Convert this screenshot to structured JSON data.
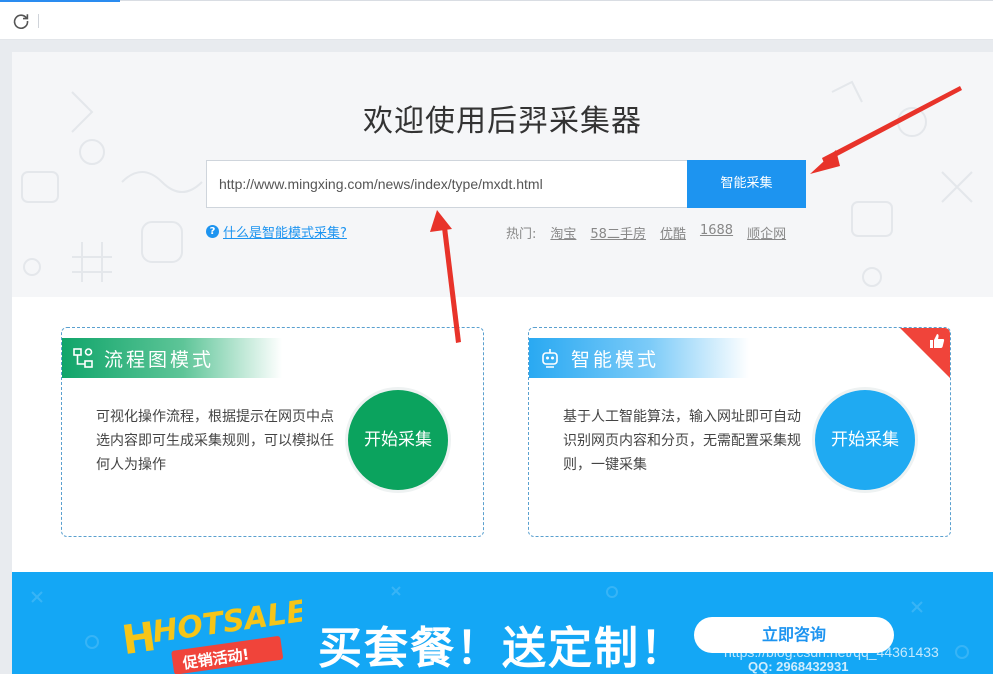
{
  "browser": {
    "refresh_icon": "refresh-icon"
  },
  "hero": {
    "title": "欢迎使用后羿采集器",
    "url_value": "http://www.mingxing.com/news/index/type/mxdt.html",
    "smart_button": "智能采集",
    "help_text": "什么是智能模式采集?",
    "hot_label": "热门:",
    "hot_links": [
      "淘宝",
      "58二手房",
      "优酷",
      "1688",
      "顺企网"
    ]
  },
  "cards": [
    {
      "title": "流程图模式",
      "icon": "flowchart-icon",
      "description": "可视化操作流程，根据提示在网页中点选内容即可生成采集规则，可以模拟任何人为操作",
      "button": "开始采集",
      "color": "#0ba35e"
    },
    {
      "title": "智能模式",
      "icon": "robot-icon",
      "description": "基于人工智能算法，输入网址即可自动识别网页内容和分页，无需配置采集规则，一键采集",
      "button": "开始采集",
      "color": "#1faaf2",
      "corner_icon": "thumbs-up-icon"
    }
  ],
  "banner": {
    "hotsale_logo": "HOTSALE",
    "hotsale_sub": "促销活动!",
    "slogan": "买套餐！送定制！",
    "consult_button": "立即咨询"
  },
  "watermark": {
    "line1": "https://blog.csdn.net/qq_44361433",
    "line2": "QQ: 2968432931"
  },
  "colors": {
    "accent": "#1d94f0",
    "green": "#0ba35e",
    "red_arrow": "#e8332a",
    "banner": "#14a7f5"
  }
}
